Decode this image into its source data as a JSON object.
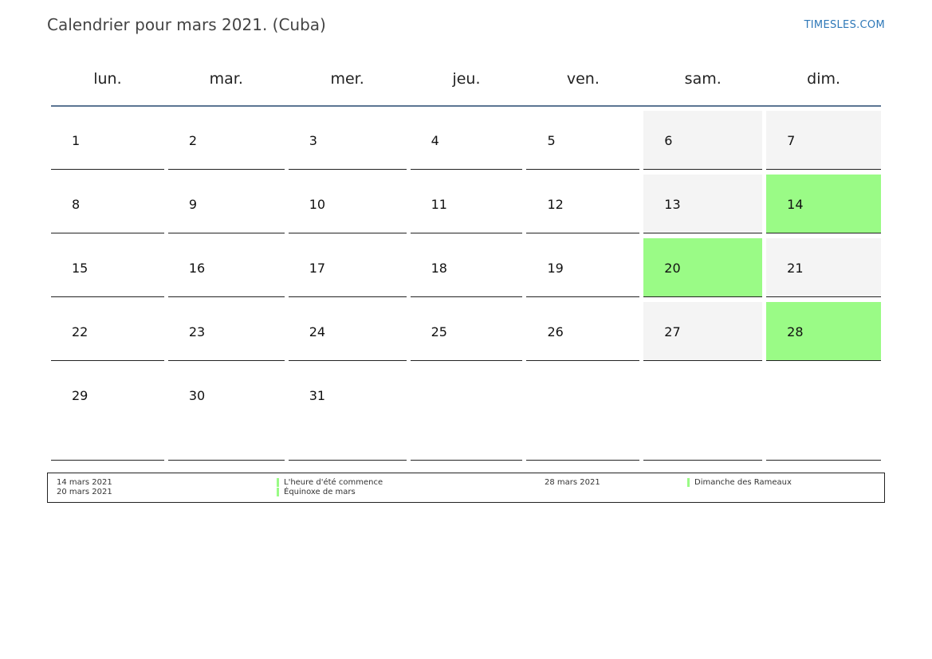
{
  "header": {
    "title": "Calendrier pour mars 2021. (Cuba)",
    "brand": "TIMESLES.COM"
  },
  "weekdays": [
    "lun.",
    "mar.",
    "mer.",
    "jeu.",
    "ven.",
    "sam.",
    "dim."
  ],
  "weeks": [
    [
      {
        "day": "1"
      },
      {
        "day": "2"
      },
      {
        "day": "3"
      },
      {
        "day": "4"
      },
      {
        "day": "5"
      },
      {
        "day": "6",
        "weekend": true
      },
      {
        "day": "7",
        "weekend": true
      }
    ],
    [
      {
        "day": "8"
      },
      {
        "day": "9"
      },
      {
        "day": "10"
      },
      {
        "day": "11"
      },
      {
        "day": "12"
      },
      {
        "day": "13",
        "weekend": true
      },
      {
        "day": "14",
        "holiday": true
      }
    ],
    [
      {
        "day": "15"
      },
      {
        "day": "16"
      },
      {
        "day": "17"
      },
      {
        "day": "18"
      },
      {
        "day": "19"
      },
      {
        "day": "20",
        "holiday": true
      },
      {
        "day": "21",
        "weekend": true
      }
    ],
    [
      {
        "day": "22"
      },
      {
        "day": "23"
      },
      {
        "day": "24"
      },
      {
        "day": "25"
      },
      {
        "day": "26"
      },
      {
        "day": "27",
        "weekend": true
      },
      {
        "day": "28",
        "holiday": true
      }
    ],
    [
      {
        "day": "29"
      },
      {
        "day": "30"
      },
      {
        "day": "31"
      },
      {
        "day": ""
      },
      {
        "day": ""
      },
      {
        "day": ""
      },
      {
        "day": ""
      }
    ]
  ],
  "legend": {
    "entries": [
      {
        "date": "14 mars 2021",
        "event": "L'heure d'été commence"
      },
      {
        "date": "20 mars 2021",
        "event": "Équinoxe de mars"
      },
      {
        "date": "28 mars 2021",
        "event": "Dimanche des Rameaux"
      }
    ]
  },
  "colors": {
    "holiday": "#9afb86",
    "weekend": "#f4f4f4",
    "header_rule": "#5b7593",
    "brand": "#2e78b8"
  }
}
